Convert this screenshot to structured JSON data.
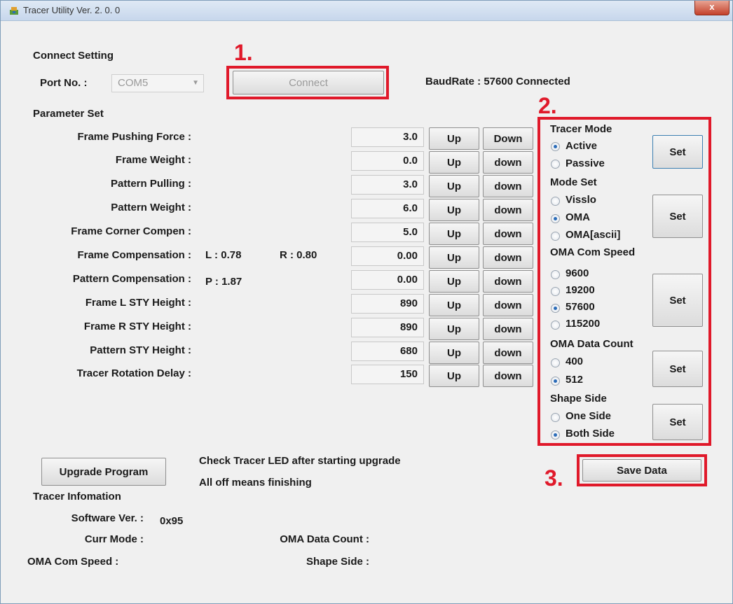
{
  "window": {
    "title": "Tracer Utility Ver. 2. 0. 0",
    "close_label": "x"
  },
  "connect": {
    "section_label": "Connect Setting",
    "port_label": "Port No. :",
    "port_value": "COM5",
    "connect_label": "Connect",
    "status": "BaudRate : 57600 Connected"
  },
  "steps": {
    "one": "1.",
    "two": "2.",
    "three": "3."
  },
  "params": {
    "section_label": "Parameter Set",
    "rows": [
      {
        "label": "Frame Pushing Force :",
        "value": "3.0",
        "up": "Up",
        "down": "Down"
      },
      {
        "label": "Frame Weight :",
        "value": "0.0",
        "up": "Up",
        "down": "down"
      },
      {
        "label": "Pattern Pulling :",
        "value": "3.0",
        "up": "Up",
        "down": "down"
      },
      {
        "label": "Pattern Weight :",
        "value": "6.0",
        "up": "Up",
        "down": "down"
      },
      {
        "label": "Frame Corner Compen :",
        "value": "5.0",
        "up": "Up",
        "down": "down"
      },
      {
        "label": "Frame Compensation :",
        "value": "0.00",
        "up": "Up",
        "down": "down"
      },
      {
        "label": "Pattern Compensation :",
        "value": "0.00",
        "up": "Up",
        "down": "down"
      },
      {
        "label": "Frame L STY Height :",
        "value": "890",
        "up": "Up",
        "down": "down"
      },
      {
        "label": "Frame R STY Height :",
        "value": "890",
        "up": "Up",
        "down": "down"
      },
      {
        "label": "Pattern STY Height :",
        "value": "680",
        "up": "Up",
        "down": "down"
      },
      {
        "label": "Tracer Rotation Delay :",
        "value": "150",
        "up": "Up",
        "down": "down"
      }
    ],
    "frame_comp_l": "L : 0.78",
    "frame_comp_r": "R : 0.80",
    "pattern_comp_p": "P : 1.87"
  },
  "tracer_mode": {
    "title": "Tracer Mode",
    "options": [
      "Active",
      "Passive"
    ],
    "selected": "Active",
    "set_label": "Set"
  },
  "mode_set": {
    "title": "Mode Set",
    "options": [
      "Visslo",
      "OMA",
      "OMA[ascii]"
    ],
    "selected": "OMA",
    "set_label": "Set"
  },
  "oma_speed": {
    "title": "OMA Com Speed",
    "options": [
      "9600",
      "19200",
      "57600",
      "115200"
    ],
    "selected": "57600",
    "set_label": "Set"
  },
  "oma_count": {
    "title": "OMA Data Count",
    "options": [
      "400",
      "512"
    ],
    "selected": "512",
    "set_label": "Set"
  },
  "shape_side": {
    "title": "Shape Side",
    "options": [
      "One Side",
      "Both Side"
    ],
    "selected": "Both Side",
    "set_label": "Set"
  },
  "save_label": "Save Data",
  "upgrade": {
    "button_label": "Upgrade Program",
    "note1": "Check Tracer LED after starting upgrade",
    "note2": "All off means finishing"
  },
  "info": {
    "section_label": "Tracer Infomation",
    "software_label": "Software Ver. :",
    "software_value": "0x95",
    "curr_mode_label": "Curr Mode :",
    "oma_count_label": "OMA Data Count :",
    "oma_speed_label": "OMA Com Speed :",
    "shape_side_label": "Shape Side :"
  },
  "colors": {
    "highlight_red": "#e0192a",
    "radio_dot": "#2b6cb8"
  }
}
